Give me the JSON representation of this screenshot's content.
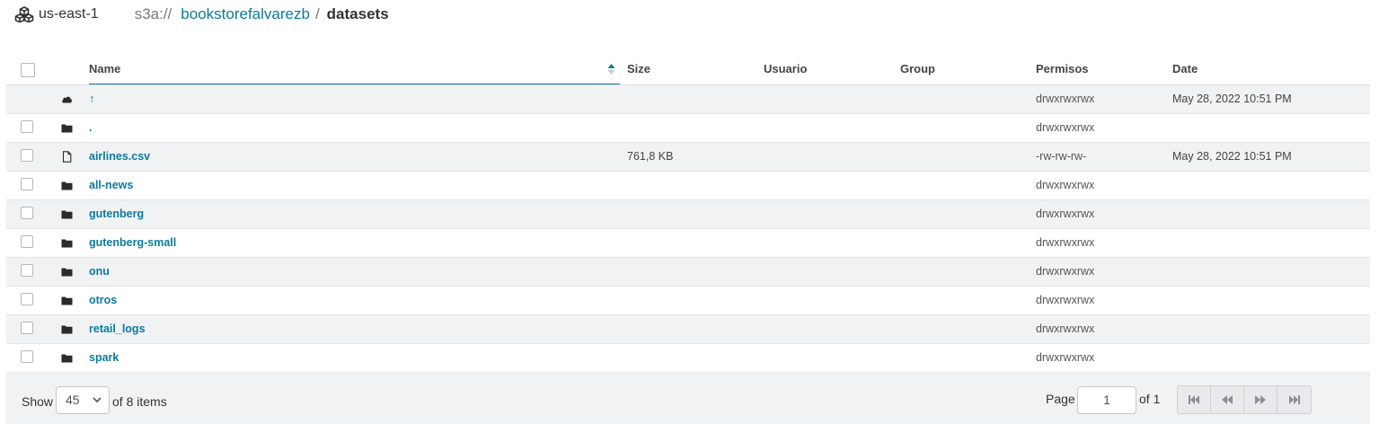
{
  "header": {
    "region": "us-east-1",
    "region_icon": "cubes-icon",
    "breadcrumb": {
      "scheme": "s3a://",
      "bucket": "bookstorefalvarezb",
      "separator": "/",
      "current": "datasets"
    }
  },
  "table": {
    "columns": {
      "name": "Name",
      "size": "Size",
      "user": "Usuario",
      "group": "Group",
      "permissions": "Permisos",
      "date": "Date"
    },
    "sort": {
      "column": "name",
      "direction": "ascending"
    },
    "rows": [
      {
        "icon": "cloud-icon",
        "name": "↑",
        "size": "",
        "user": "",
        "group": "",
        "permissions": "drwxrwxrwx",
        "date": "May 28, 2022 10:51 PM",
        "has_checkbox": false
      },
      {
        "icon": "folder-icon",
        "name": ".",
        "size": "",
        "user": "",
        "group": "",
        "permissions": "drwxrwxrwx",
        "date": "",
        "has_checkbox": true
      },
      {
        "icon": "file-icon",
        "name": "airlines.csv",
        "size": "761,8 KB",
        "user": "",
        "group": "",
        "permissions": "-rw-rw-rw-",
        "date": "May 28, 2022 10:51 PM",
        "has_checkbox": true
      },
      {
        "icon": "folder-icon",
        "name": "all-news",
        "size": "",
        "user": "",
        "group": "",
        "permissions": "drwxrwxrwx",
        "date": "",
        "has_checkbox": true
      },
      {
        "icon": "folder-icon",
        "name": "gutenberg",
        "size": "",
        "user": "",
        "group": "",
        "permissions": "drwxrwxrwx",
        "date": "",
        "has_checkbox": true
      },
      {
        "icon": "folder-icon",
        "name": "gutenberg-small",
        "size": "",
        "user": "",
        "group": "",
        "permissions": "drwxrwxrwx",
        "date": "",
        "has_checkbox": true
      },
      {
        "icon": "folder-icon",
        "name": "onu",
        "size": "",
        "user": "",
        "group": "",
        "permissions": "drwxrwxrwx",
        "date": "",
        "has_checkbox": true
      },
      {
        "icon": "folder-icon",
        "name": "otros",
        "size": "",
        "user": "",
        "group": "",
        "permissions": "drwxrwxrwx",
        "date": "",
        "has_checkbox": true
      },
      {
        "icon": "folder-icon",
        "name": "retail_logs",
        "size": "",
        "user": "",
        "group": "",
        "permissions": "drwxrwxrwx",
        "date": "",
        "has_checkbox": true
      },
      {
        "icon": "folder-icon",
        "name": "spark",
        "size": "",
        "user": "",
        "group": "",
        "permissions": "drwxrwxrwx",
        "date": "",
        "has_checkbox": true
      }
    ]
  },
  "footer": {
    "show_label": "Show",
    "page_size": "45",
    "items_label": "of 8 items",
    "page_label": "Page",
    "page_value": "1",
    "of_pages": "of 1",
    "pager_buttons": [
      "first-page-icon",
      "previous-page-icon",
      "next-page-icon",
      "last-page-icon"
    ]
  },
  "colors": {
    "link": "#0b7a9f",
    "row_alt": "#f1f2f4",
    "text": "#333333"
  }
}
